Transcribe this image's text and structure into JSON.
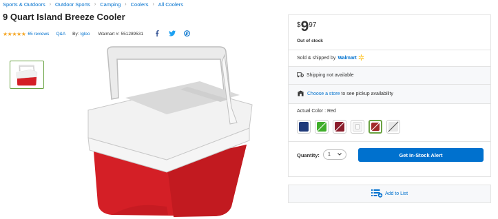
{
  "breadcrumb": [
    "Sports & Outdoors",
    "Outdoor Sports",
    "Camping",
    "Coolers",
    "All Coolers"
  ],
  "product": {
    "title": "9 Quart Island Breeze Cooler",
    "rating_stars": "★★★★★",
    "rating_value": 4.5,
    "reviews": "65 reviews",
    "qa": "Q&A",
    "by_label": "By:",
    "brand": "Igloo",
    "walmart_number": "Walmart #: 551289531"
  },
  "buybox": {
    "price_currency": "$",
    "price_dollars": "9",
    "price_cents": "97",
    "stock_status": "Out of stock",
    "sold_by_prefix": "Sold & shipped by",
    "seller": "Walmart",
    "shipping": "Shipping not available",
    "pickup_link": "Choose a store",
    "pickup_text": " to see pickup availability",
    "color_label": "Actual Color : Red",
    "swatches": [
      {
        "color": "#1f3a7a",
        "available": true,
        "selected": false
      },
      {
        "color": "#3fae2a",
        "available": false,
        "selected": false
      },
      {
        "color": "#8b1d2c",
        "available": false,
        "selected": false
      },
      {
        "color": "#f4f4f4",
        "available": true,
        "selected": false
      },
      {
        "color": "#a32a2a",
        "available": false,
        "selected": true
      },
      {
        "color": "#e8e8e8",
        "available": false,
        "selected": false
      }
    ],
    "quantity_label": "Quantity:",
    "quantity_value": "1",
    "alert_button": "Get In-Stock Alert"
  },
  "add_to_list": "Add to List",
  "colors": {
    "accent": "#0071ce",
    "star": "#f5a623",
    "selected": "#6aa343",
    "cooler_red": "#d41f26"
  }
}
